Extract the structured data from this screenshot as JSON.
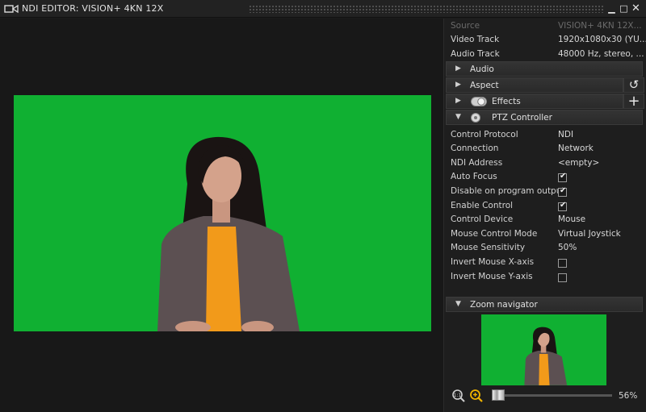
{
  "window": {
    "title": "NDI EDITOR: VISION+ 4KN 12X",
    "min_label": "▁",
    "max_label": "□",
    "close_label": "✕"
  },
  "source_info": {
    "source_label": "Source",
    "source_value": "VISION+ 4KN 12X...",
    "video_label": "Video Track",
    "video_value": "1920x1080x30 (YU...",
    "audio_label": "Audio Track",
    "audio_value": "48000 Hz, stereo, ..."
  },
  "sections": {
    "audio": "Audio",
    "aspect": "Aspect",
    "effects": "Effects",
    "ptz": "PTZ Controller",
    "zoom": "Zoom navigator"
  },
  "side_buttons": {
    "reset": "↺",
    "add": "+"
  },
  "ptz": {
    "rows": [
      {
        "label": "Control Protocol",
        "value": "NDI"
      },
      {
        "label": "Connection",
        "value": "Network"
      },
      {
        "label": "NDI Address",
        "value": "<empty>"
      },
      {
        "label": "Auto Focus",
        "checked": true
      },
      {
        "label": "Disable on program output",
        "checked": true
      },
      {
        "label": "Enable Control",
        "checked": true
      },
      {
        "label": "Control Device",
        "value": "Mouse"
      },
      {
        "label": "Mouse Control Mode",
        "value": "Virtual Joystick"
      },
      {
        "label": "Mouse Sensitivity",
        "value": "50%"
      },
      {
        "label": "Invert Mouse X-axis",
        "checked": false
      },
      {
        "label": "Invert Mouse Y-axis",
        "checked": false
      }
    ]
  },
  "zoom": {
    "value": "56%",
    "level": 0.0
  },
  "colors": {
    "chroma_green": "#10b032",
    "zoom_in_accent": "#f0b400"
  },
  "icons": {
    "app": "camera-icon",
    "zoom_fit": "zoom-fit-icon",
    "zoom_in": "zoom-in-icon",
    "effects_toggle": "toggle-icon",
    "ptz_disc": "disc-icon"
  }
}
